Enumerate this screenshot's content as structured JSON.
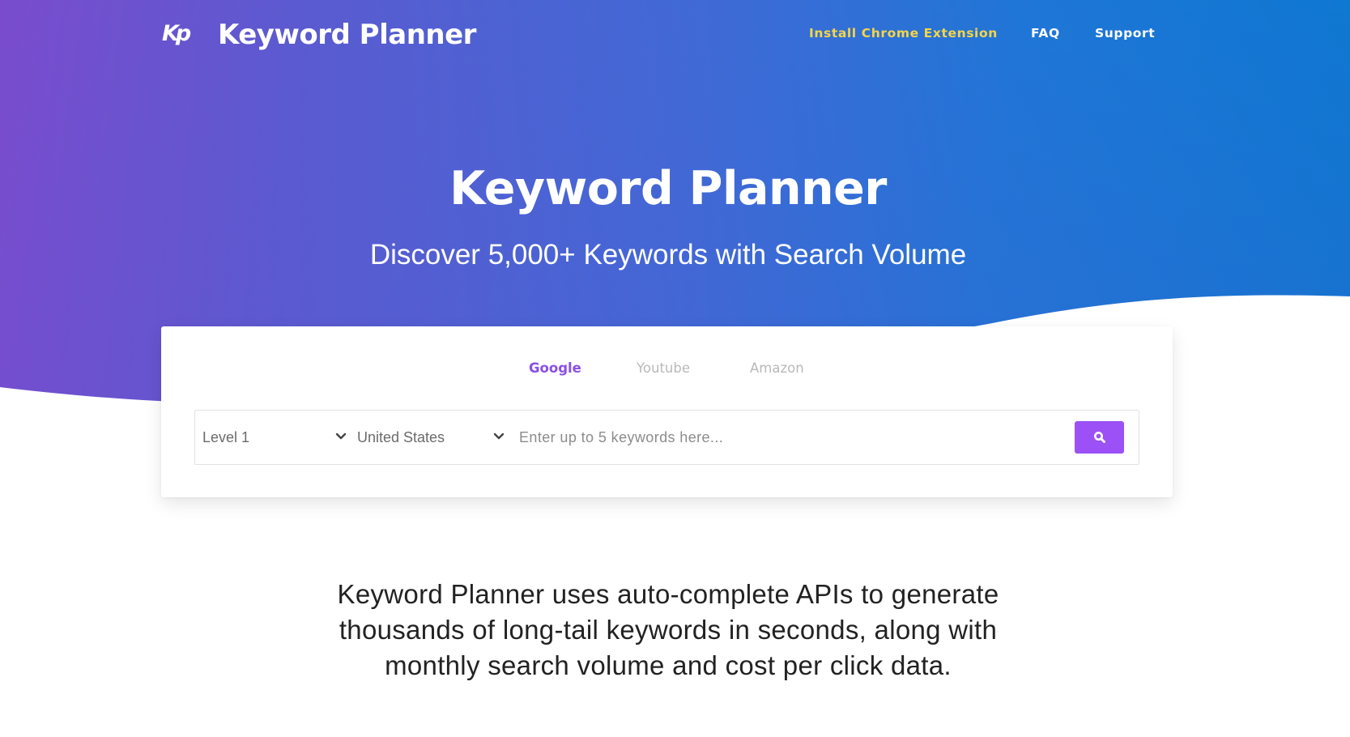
{
  "header": {
    "logo_mark": "Kp",
    "brand_name": "Keyword Planner",
    "nav": [
      {
        "label": "Install Chrome Extension",
        "color": "#f5d547"
      },
      {
        "label": "FAQ"
      },
      {
        "label": "Support"
      }
    ]
  },
  "hero": {
    "title": "Keyword Planner",
    "subtitle": "Discover 5,000+ Keywords with Search Volume",
    "gradient": {
      "start": "#7a4ccd",
      "end": "#0b78d0"
    }
  },
  "search_card": {
    "tabs": [
      {
        "label": "Google",
        "active": true
      },
      {
        "label": "Youtube",
        "active": false
      },
      {
        "label": "Amazon",
        "active": false
      }
    ],
    "level_select": {
      "value": "Level 1",
      "icon": "chevron-down-icon"
    },
    "country_select": {
      "value": "United States",
      "icon": "chevron-down-icon"
    },
    "keyword_input": {
      "value": "",
      "placeholder": "Enter up to 5 keywords here..."
    },
    "search_button": {
      "icon": "search-icon",
      "color": "#9b51f5"
    },
    "accent_color": "#8a4fe6"
  },
  "description": {
    "lines": [
      "Keyword Planner uses auto-complete APIs to generate",
      "thousands of long-tail keywords in seconds, along with",
      "monthly search volume and cost per click data."
    ]
  }
}
